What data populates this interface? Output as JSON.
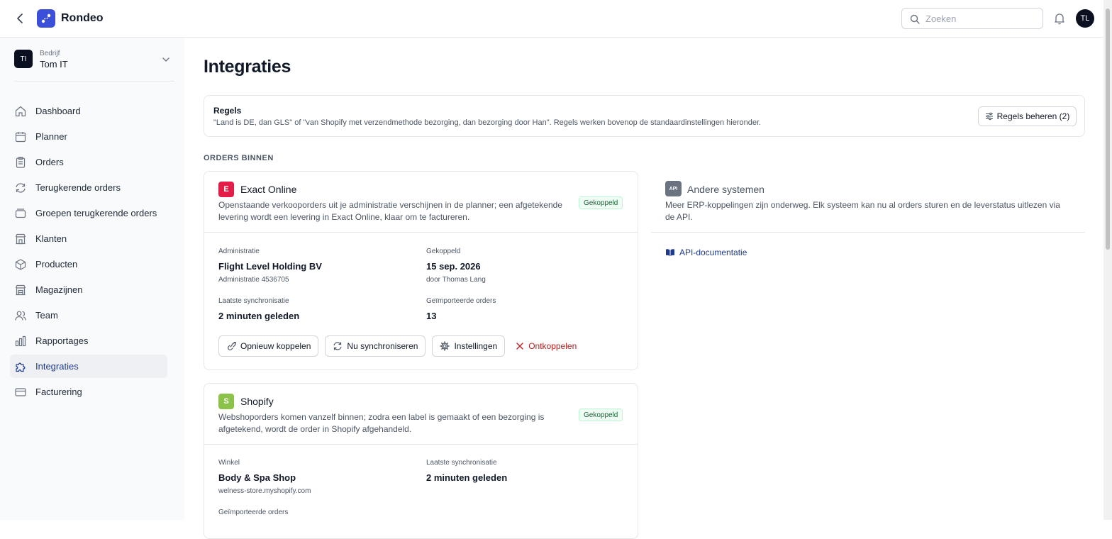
{
  "app": {
    "name": "Rondeo"
  },
  "header": {
    "search_placeholder": "Zoeken",
    "avatar_initials": "TL"
  },
  "company": {
    "badge": "TI",
    "label": "Bedrijf",
    "name": "Tom IT"
  },
  "nav": [
    {
      "label": "Dashboard",
      "icon": "home-icon"
    },
    {
      "label": "Planner",
      "icon": "calendar-icon"
    },
    {
      "label": "Orders",
      "icon": "clipboard-icon"
    },
    {
      "label": "Terugkerende orders",
      "icon": "repeat-icon"
    },
    {
      "label": "Groepen terugkerende orders",
      "icon": "folder-icon"
    },
    {
      "label": "Klanten",
      "icon": "building-icon"
    },
    {
      "label": "Producten",
      "icon": "box-icon"
    },
    {
      "label": "Magazijnen",
      "icon": "warehouse-icon"
    },
    {
      "label": "Team",
      "icon": "users-icon"
    },
    {
      "label": "Rapportages",
      "icon": "bar-chart-icon"
    },
    {
      "label": "Integraties",
      "icon": "puzzle-icon",
      "active": true
    },
    {
      "label": "Facturering",
      "icon": "credit-card-icon"
    }
  ],
  "page": {
    "title": "Integraties"
  },
  "rules": {
    "title": "Regels",
    "description": "\"Land is DE, dan GLS\" of \"van Shopify met verzendmethode bezorging, dan bezorging door Han\". Regels werken bovenop de standaardinstellingen hieronder.",
    "button": "Regels beheren (2)"
  },
  "section_label": "ORDERS BINNEN",
  "exact": {
    "logo": "E",
    "name": "Exact Online",
    "description": "Openstaande verkooporders uit je administratie verschijnen in de planner; een afgetekende levering wordt een levering in Exact Online, klaar om te factureren.",
    "status": "Gekoppeld",
    "admin_label": "Administratie",
    "admin_value": "Flight Level Holding BV",
    "admin_sub": "Administratie 4536705",
    "linked_label": "Gekoppeld",
    "linked_value": "15 sep. 2026",
    "linked_sub": "door Thomas Lang",
    "sync_label": "Laatste synchronisatie",
    "sync_value": "2 minuten geleden",
    "imported_label": "Geïmporteerde orders",
    "imported_value": "13",
    "btn_relink": "Opnieuw koppelen",
    "btn_sync": "Nu synchroniseren",
    "btn_settings": "Instellingen",
    "btn_unlink": "Ontkoppelen"
  },
  "shopify": {
    "logo": "S",
    "name": "Shopify",
    "description": "Webshoporders komen vanzelf binnen; zodra een label is gemaakt of een bezorging is afgetekend, wordt de order in Shopify afgehandeld.",
    "status": "Gekoppeld",
    "shop_label": "Winkel",
    "shop_value": "Body & Spa Shop",
    "shop_sub": "welness-store.myshopify.com",
    "sync_label": "Laatste synchronisatie",
    "sync_value": "2 minuten geleden",
    "imported_label": "Geïmporteerde orders"
  },
  "other": {
    "logo": "API",
    "title": "Andere systemen",
    "description": "Meer ERP-koppelingen zijn onderweg. Elk systeem kan nu al orders sturen en de leverstatus uitlezen via de API.",
    "link": "API-documentatie"
  },
  "colors": {
    "brand": "#3b4fd8",
    "exact": "#e11d48",
    "shopify": "#8bc34a",
    "success": "#166534",
    "danger": "#b91c1c",
    "link": "#1e3a8a"
  }
}
